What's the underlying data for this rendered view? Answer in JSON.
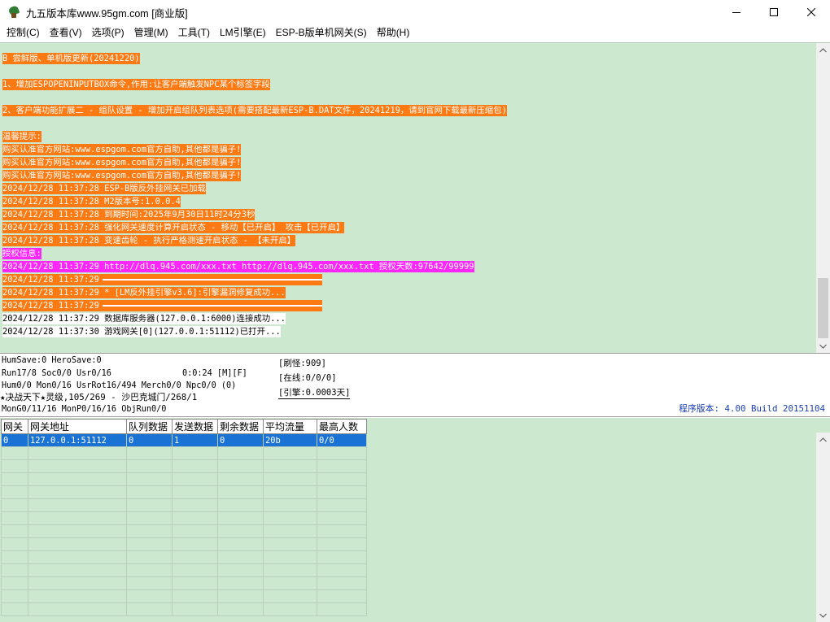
{
  "window": {
    "title": "九五版本库www.95gm.com [商业版]",
    "minimize": "minimize",
    "maximize": "maximize",
    "close": "close"
  },
  "menu": [
    "控制(C)",
    "查看(V)",
    "选项(P)",
    "管理(M)",
    "工具(T)",
    "LM引擎(E)",
    "ESP-B版单机网关(S)",
    "帮助(H)"
  ],
  "log": {
    "l1": "B 尝鲜版、单机版更新(20241220)",
    "l2": "1、增加ESPOPENINPUTBOX命令,作用:让客户端触发NPC某个标签字段",
    "l3": "2、客户端功能扩展二 - 组队设置 - 增加开启组队列表选项(需要搭配最新ESP-B.DAT文件，20241219，请到官网下载最新压缩包)",
    "l4": "温馨提示:",
    "l5": "购买认准官方网站:www.espgom.com官方自助,其他都是骗子!",
    "l6": "购买认准官方网站:www.espgom.com官方自助,其他都是骗子!",
    "l7": "购买认准官方网站:www.espgom.com官方自助,其他都是骗子!",
    "l8": "2024/12/28 11:37:28 ESP-B版反外挂网关已加载",
    "l9": "2024/12/28 11:37:28 M2版本号:1.0.0.4",
    "l10": "2024/12/28 11:37:28 到期时间:2025年9月30日11时24分3秒",
    "l11": "2024/12/28 11:37:28 强化网关速度计算开启状态 - 移动【已开启】 攻击【已开启】",
    "l12": "2024/12/28 11:37:28 变速齿轮 - 执行严格测速开启状态 - 【未开启】",
    "l13": "授权信息:",
    "l14": "2024/12/28 11:37:29 http://dlq.945.com/xxx.txt http://dlq.945.com/xxx.txt 授权天数:97642/99999",
    "l15": "2024/12/28 11:37:29",
    "l16": "2024/12/28 11:37:29 * [LM反外挂引擎v3.6]:引擎漏洞修复成功...",
    "l17": "2024/12/28 11:37:29",
    "l18": "2024/12/28 11:37:29 数据库服务器(127.0.0.1:6000)连接成功...",
    "l19": "2024/12/28 11:37:30 游戏网关[0](127.0.0.1:51112)已打开..."
  },
  "status": {
    "s1": "HumSave:0 HeroSave:0",
    "s2a": "Run17/8 Soc0/0 Usr0/16",
    "s2b": "0:0:24 [M][F]",
    "s3": "Hum0/0 Mon0/16 UsrRot16/494 Merch0/0 Npc0/0 (0)",
    "s4": "★决战天下★灵级,105/269 - 沙巴克城门/268/1",
    "s5": "MonG0/11/16 MonP0/16/16 ObjRun0/0",
    "r1": "[刷怪:909]",
    "r2": "[在线:0/0/0]",
    "r3": "[引擎:0.0003天]",
    "version": "程序版本: 4.00 Build 20151104"
  },
  "grid": {
    "headers": [
      "网关",
      "网关地址",
      "队列数据",
      "发送数据",
      "剩余数据",
      "平均流量",
      "最高人数"
    ],
    "row": [
      "0",
      "127.0.0.1:51112",
      "0",
      "1",
      "0",
      "20b",
      "0/0"
    ]
  },
  "colors": {
    "log_bg": "#cce8cf",
    "orange_highlight": "#ff7a12",
    "magenta_highlight": "#ff26ff",
    "selection": "#1a72d4",
    "version_text": "#1a3fb8"
  }
}
